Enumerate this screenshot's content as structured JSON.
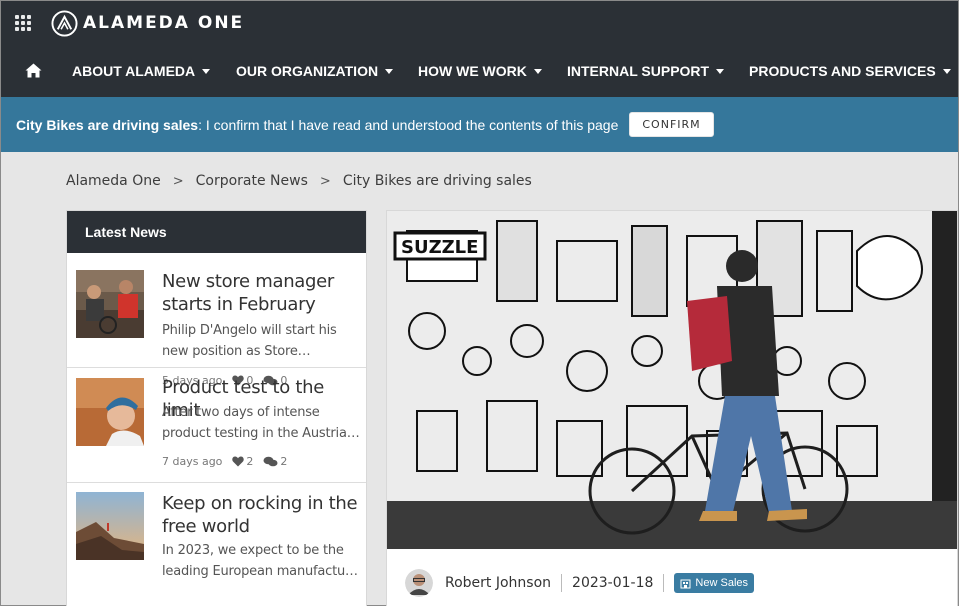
{
  "app": {
    "brand": "ALAMEDA ONE",
    "icons": {
      "apps": "waffle-icon",
      "home": "home-icon",
      "caret": "caret-down-icon"
    }
  },
  "nav": {
    "items": [
      {
        "label": "ABOUT ALAMEDA"
      },
      {
        "label": "OUR ORGANIZATION"
      },
      {
        "label": "HOW WE WORK"
      },
      {
        "label": "INTERNAL SUPPORT"
      },
      {
        "label": "PRODUCTS AND SERVICES"
      }
    ]
  },
  "notice": {
    "title": "City Bikes are driving sales",
    "message": ": I confirm that I have read and understood the contents of this page",
    "confirm_label": "CONFIRM"
  },
  "breadcrumb": {
    "items": [
      "Alameda One",
      "Corporate News",
      "City Bikes are driving sales"
    ],
    "separator": ">"
  },
  "latest_news": {
    "heading": "Latest News",
    "items": [
      {
        "title": "New store manager starts in February",
        "excerpt": "Philip D'Angelo will start his new position as Store…",
        "date": "5 days ago",
        "likes": "0",
        "comments": "0"
      },
      {
        "title": "Product test to the limit",
        "excerpt": "After two days of intense product testing in the Austria…",
        "date": "7 days ago",
        "likes": "2",
        "comments": "2"
      },
      {
        "title": "Keep on rocking in the free world",
        "excerpt": "In 2023, we expect to be the leading European manufactu…",
        "date": "",
        "likes": "",
        "comments": ""
      }
    ]
  },
  "article": {
    "author": "Robert Johnson",
    "date": "2023-01-18",
    "tag": "New Sales",
    "hero_sign": "SUZZLE"
  },
  "colors": {
    "topbar": "#2b3036",
    "notice": "#35779b",
    "tag": "#3a7ca2"
  }
}
